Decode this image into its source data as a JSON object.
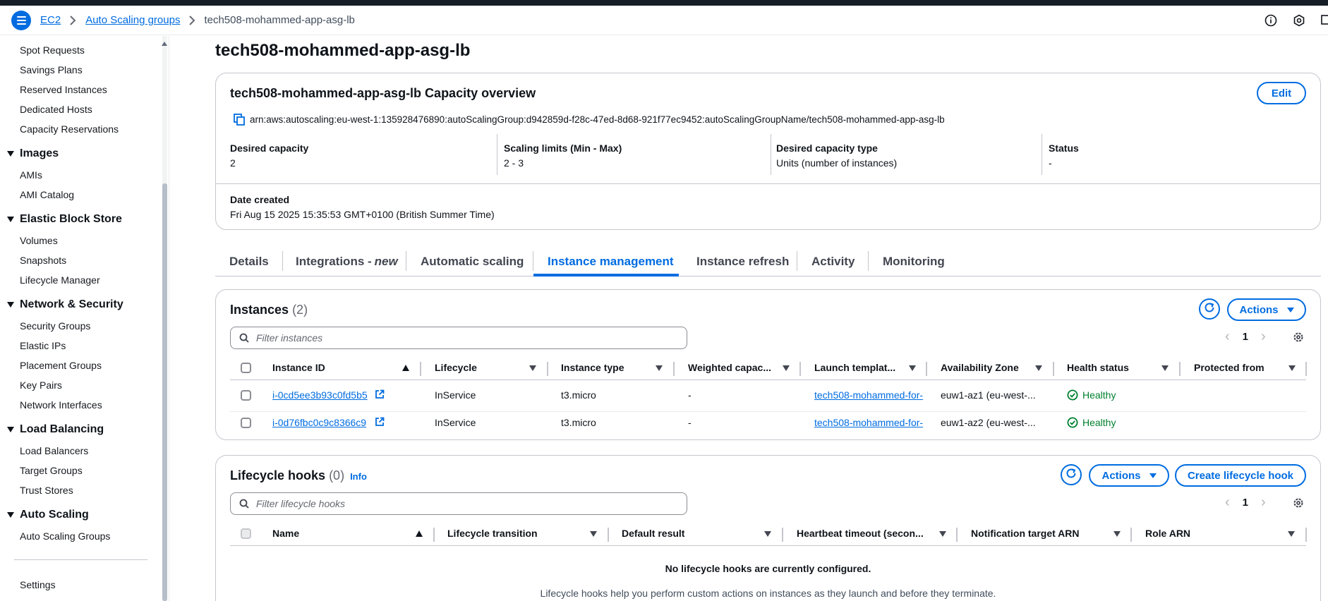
{
  "breadcrumb": {
    "items": [
      "EC2",
      "Auto Scaling groups"
    ],
    "current": "tech508-mohammed-app-asg-lb"
  },
  "sidebar": {
    "links_top": [
      "Spot Requests",
      "Savings Plans",
      "Reserved Instances",
      "Dedicated Hosts",
      "Capacity Reservations"
    ],
    "sections": [
      {
        "title": "Images",
        "items": [
          "AMIs",
          "AMI Catalog"
        ]
      },
      {
        "title": "Elastic Block Store",
        "items": [
          "Volumes",
          "Snapshots",
          "Lifecycle Manager"
        ]
      },
      {
        "title": "Network & Security",
        "items": [
          "Security Groups",
          "Elastic IPs",
          "Placement Groups",
          "Key Pairs",
          "Network Interfaces"
        ]
      },
      {
        "title": "Load Balancing",
        "items": [
          "Load Balancers",
          "Target Groups",
          "Trust Stores"
        ]
      },
      {
        "title": "Auto Scaling",
        "items": [
          "Auto Scaling Groups"
        ]
      }
    ],
    "settings": "Settings"
  },
  "page": {
    "title": "tech508-mohammed-app-asg-lb"
  },
  "capacity": {
    "title": "tech508-mohammed-app-asg-lb Capacity overview",
    "edit_label": "Edit",
    "arn": "arn:aws:autoscaling:eu-west-1:135928476890:autoScalingGroup:d942859d-f28c-47ed-8d68-921f77ec9452:autoScalingGroupName/tech508-mohammed-app-asg-lb",
    "fields": [
      {
        "label": "Desired capacity",
        "value": "2"
      },
      {
        "label": "Scaling limits (Min - Max)",
        "value": "2 - 3"
      },
      {
        "label": "Desired capacity type",
        "value": "Units (number of instances)"
      },
      {
        "label": "Status",
        "value": "-"
      }
    ],
    "date_label": "Date created",
    "date_value": "Fri Aug 15 2025 15:35:53 GMT+0100 (British Summer Time)"
  },
  "tabs": {
    "details": "Details",
    "integrations": "Integrations - ",
    "integrations_new": "new",
    "automatic_scaling": "Automatic scaling",
    "instance_management": "Instance management",
    "instance_refresh": "Instance refresh",
    "activity": "Activity",
    "monitoring": "Monitoring"
  },
  "instances": {
    "title": "Instances",
    "count": "(2)",
    "actions_label": "Actions",
    "filter_placeholder": "Filter instances",
    "page": "1",
    "columns": [
      "Instance ID",
      "Lifecycle",
      "Instance type",
      "Weighted capac...",
      "Launch templat...",
      "Availability Zone",
      "Health status",
      "Protected from"
    ],
    "rows": [
      {
        "id": "i-0cd5ee3b93c0fd5b5",
        "lifecycle": "InService",
        "type": "t3.micro",
        "weighted": "-",
        "template": "tech508-mohammed-for-",
        "az": "euw1-az1 (eu-west-...",
        "health": "Healthy"
      },
      {
        "id": "i-0d76fbc0c9c8366c9",
        "lifecycle": "InService",
        "type": "t3.micro",
        "weighted": "-",
        "template": "tech508-mohammed-for-",
        "az": "euw1-az2 (eu-west-...",
        "health": "Healthy"
      }
    ]
  },
  "hooks": {
    "title": "Lifecycle hooks",
    "count": "(0)",
    "info": "Info",
    "actions_label": "Actions",
    "create_label": "Create lifecycle hook",
    "filter_placeholder": "Filter lifecycle hooks",
    "page": "1",
    "columns": [
      "Name",
      "Lifecycle transition",
      "Default result",
      "Heartbeat timeout (secon...",
      "Notification target ARN",
      "Role ARN"
    ],
    "empty_title": "No lifecycle hooks are currently configured.",
    "empty_text": "Lifecycle hooks help you perform custom actions on instances as they launch and before they terminate."
  },
  "colors": {
    "accent": "#006ce0",
    "healthy": "#00802f",
    "topbar": "#161d26"
  },
  "icons": [
    "menu-icon",
    "chevron-right-icon",
    "info-icon",
    "settings-icon",
    "notifications-icon",
    "copy-icon",
    "refresh-icon",
    "search-icon",
    "external-link-icon",
    "check-circle-icon",
    "gear-icon"
  ]
}
